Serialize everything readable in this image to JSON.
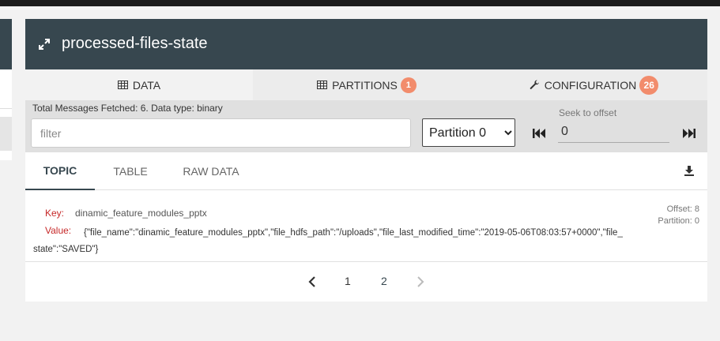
{
  "panel": {
    "title": "processed-files-state"
  },
  "tabs": [
    {
      "label": "DATA",
      "icon": "table-icon"
    },
    {
      "label": "PARTITIONS",
      "icon": "table-icon",
      "badge": "1"
    },
    {
      "label": "CONFIGURATION",
      "icon": "wrench-icon",
      "badge": "26"
    }
  ],
  "toolbar": {
    "total_messages": "Total Messages Fetched: 6. Data type: binary",
    "filter_placeholder": "filter",
    "partition_selected": "Partition 0",
    "seek_label": "Seek to offset",
    "seek_value": "0"
  },
  "subtabs": [
    {
      "label": "TOPIC"
    },
    {
      "label": "TABLE"
    },
    {
      "label": "RAW DATA"
    }
  ],
  "message": {
    "key_label": "Key:",
    "key": "dinamic_feature_modules_pptx",
    "value_label": "Value:",
    "value": "{\"file_name\":\"dinamic_feature_modules_pptx\",\"file_hdfs_path\":\"/uploads\",\"file_last_modified_time\":\"2019-05-06T08:03:57+0000\",\"file_state\":\"SAVED\"}",
    "offset": "Offset: 8",
    "partition": "Partition: 0"
  },
  "pagination": {
    "pages": [
      "1",
      "2"
    ],
    "current": "2"
  },
  "colors": {
    "header": "#37474f",
    "badge": "#f28c6c",
    "key_label": "#c62828"
  }
}
